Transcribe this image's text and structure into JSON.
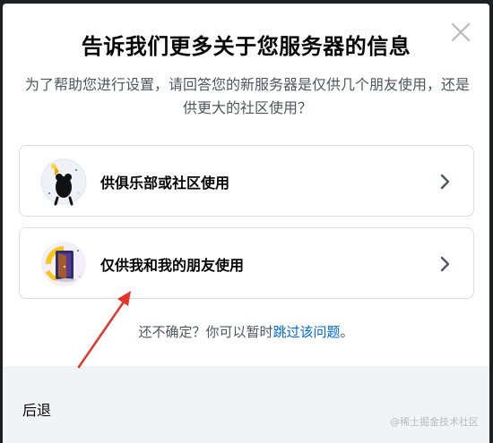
{
  "modal": {
    "title": "告诉我们更多关于您服务器的信息",
    "subtitle": "为了帮助您进行设置，请回答您的新服务器是仅供几个朋友使用，还是供更大的社区使用？"
  },
  "options": [
    {
      "label": "供俱乐部或社区使用",
      "icon": "club-community-icon"
    },
    {
      "label": "仅供我和我的朋友使用",
      "icon": "friends-door-icon"
    }
  ],
  "unsure": {
    "prefix": "还不确定？你可以暂时",
    "link": "跳过该问题",
    "suffix": "。"
  },
  "footer": {
    "back_label": "后退",
    "watermark": "@稀土掘金技术社区"
  },
  "colors": {
    "link": "#0068e0",
    "annotation_arrow": "#e8332a"
  }
}
